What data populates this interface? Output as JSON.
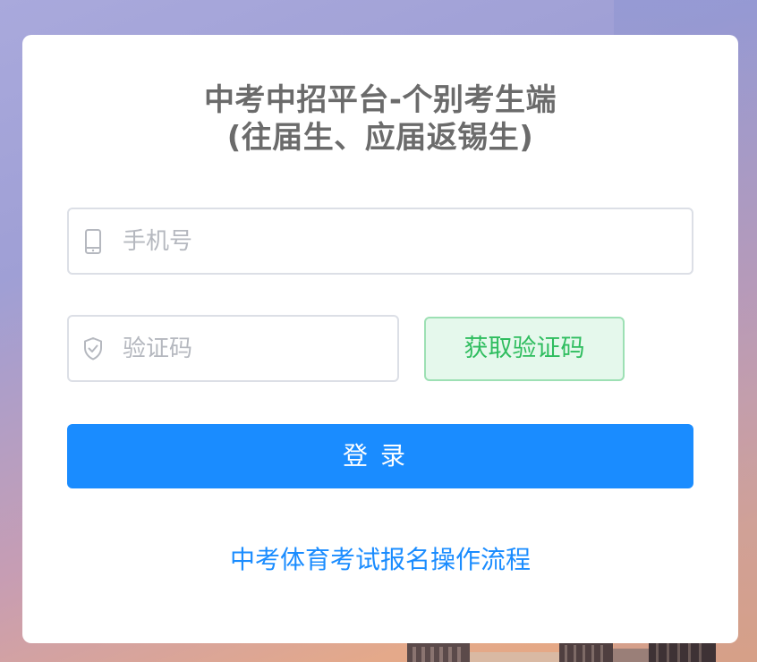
{
  "page": {
    "title_line1": "中考中招平台-个别考生端",
    "title_line2": "(往届生、应届返锡生)"
  },
  "form": {
    "phone": {
      "placeholder": "手机号",
      "value": "",
      "icon": "mobile-phone-icon"
    },
    "code": {
      "placeholder": "验证码",
      "value": "",
      "icon": "shield-check-icon"
    },
    "get_code_label": "获取验证码",
    "login_label": "登录"
  },
  "links": {
    "process_link": "中考体育考试报名操作流程"
  },
  "colors": {
    "primary": "#1a8cff",
    "success_text": "#2fbd5f",
    "success_bg": "#e5f8ec",
    "title_text": "#6b6b6b"
  }
}
